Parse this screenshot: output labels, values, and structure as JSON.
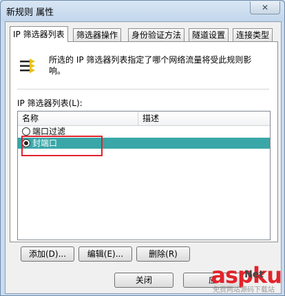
{
  "window": {
    "title": "新规则 属性",
    "close_glyph": "✕"
  },
  "tabs": [
    {
      "label": "IP 筛选器列表",
      "active": true
    },
    {
      "label": "筛选器操作",
      "active": false
    },
    {
      "label": "身份验证方法",
      "active": false
    },
    {
      "label": "隧道设置",
      "active": false
    },
    {
      "label": "连接类型",
      "active": false
    }
  ],
  "panel": {
    "info_text": "所选的 IP 筛选器列表指定了哪个网络流量将受此规则影响。",
    "list_label": "IP 筛选器列表(L):",
    "columns": {
      "name": "名称",
      "desc": "描述"
    },
    "rows": [
      {
        "name": "端口过滤",
        "selected": false,
        "checked": false
      },
      {
        "name": "封端口",
        "selected": true,
        "checked": true
      }
    ]
  },
  "buttons": {
    "add": "添加(D)...",
    "edit": "编辑(E)...",
    "delete": "删除(R)",
    "close": "关闭",
    "apply_partial": "应"
  },
  "watermark": {
    "brand": "aspku",
    "suffix": "Net",
    "sub": "免费网站源码下载站"
  },
  "colors": {
    "selection": "#3aa6a8",
    "highlight_box": "#e0232c",
    "watermark": "#e2232a"
  }
}
